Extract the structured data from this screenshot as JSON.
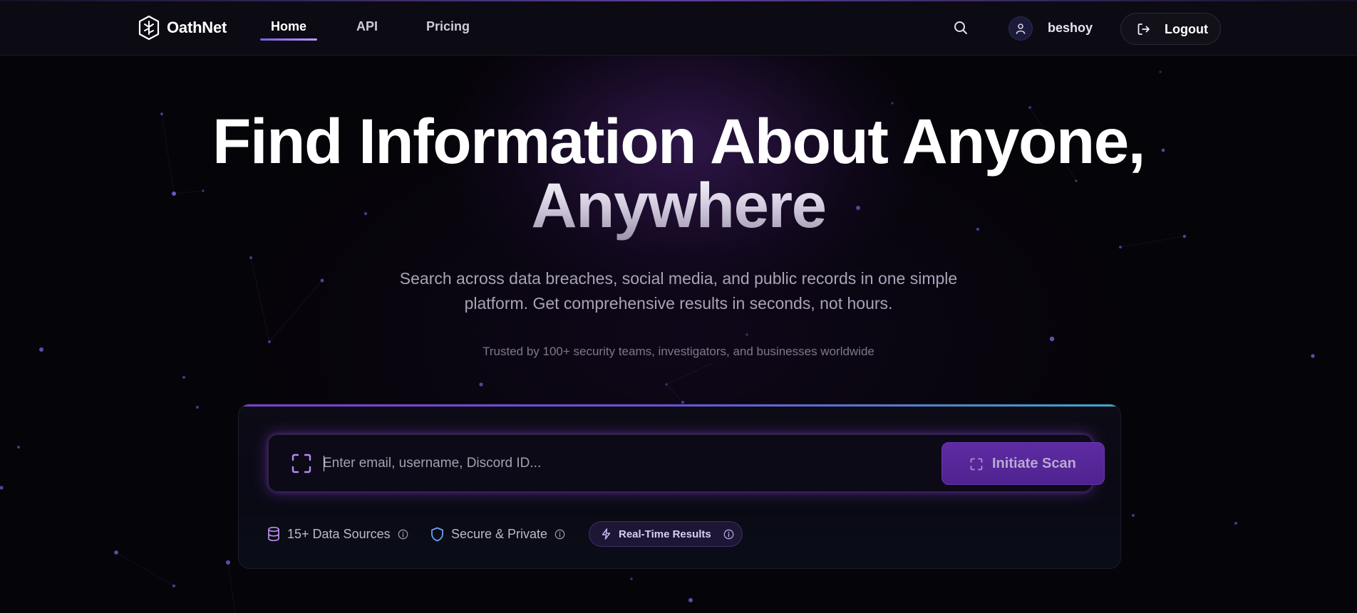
{
  "brand": {
    "name": "OathNet",
    "accent": "#8b5cf6"
  },
  "nav": {
    "links": [
      {
        "label": "Home",
        "active": true
      },
      {
        "label": "API",
        "active": false
      },
      {
        "label": "Pricing",
        "active": false
      }
    ],
    "search_icon": "search-icon",
    "user": {
      "name": "beshoy",
      "icon": "user-icon"
    },
    "logout_label": "Logout"
  },
  "hero": {
    "title_line1": "Find Information About Anyone,",
    "title_line2": "Anywhere",
    "subtitle_line1": "Search across data breaches, social media, and public records in one simple",
    "subtitle_line2": "platform. Get comprehensive results in seconds, not hours.",
    "trusted": "Trusted by 100+ security teams, investigators, and businesses worldwide"
  },
  "search": {
    "placeholder": "Enter email, username, Discord ID...",
    "value": "",
    "button_label": "Initiate Scan",
    "features": [
      {
        "label": "15+ Data Sources",
        "icon": "database-icon",
        "info_icon": "info-icon"
      },
      {
        "label": "Secure & Private",
        "icon": "shield-icon",
        "info_icon": "info-icon"
      },
      {
        "label": "Real-Time Results",
        "icon": "lightning-icon",
        "info_icon": "info-icon",
        "highlighted": true
      }
    ]
  }
}
